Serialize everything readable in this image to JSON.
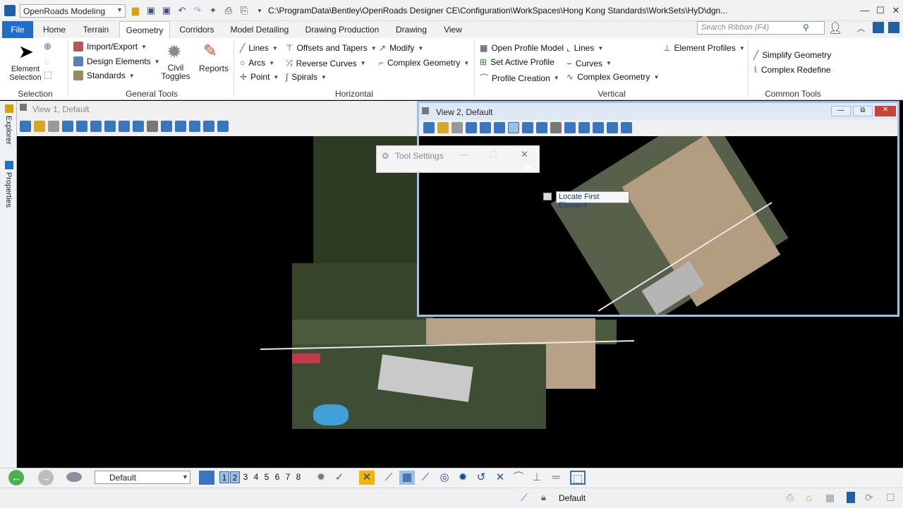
{
  "app": {
    "workspace": "OpenRoads Modeling",
    "path": "C:\\ProgramData\\Bentley\\OpenRoads Designer CE\\Configuration\\WorkSpaces\\Hong Kong Standards\\WorkSets\\HyD\\dgn..."
  },
  "tabs": [
    "File",
    "Home",
    "Terrain",
    "Geometry",
    "Corridors",
    "Model Detailing",
    "Drawing Production",
    "Drawing",
    "View"
  ],
  "search": {
    "placeholder": "Search Ribbon (F4)"
  },
  "ribbon": {
    "selection": {
      "label": "Selection",
      "element_selection": "Element Selection"
    },
    "general": {
      "label": "General Tools",
      "import_export": "Import/Export",
      "design_elements": "Design Elements",
      "standards": "Standards",
      "civil_toggles": "Civil Toggles",
      "reports": "Reports"
    },
    "horizontal": {
      "label": "Horizontal",
      "lines": "Lines",
      "arcs": "Arcs",
      "point": "Point",
      "offsets": "Offsets and Tapers",
      "reverse": "Reverse Curves",
      "spirals": "Spirals",
      "modify": "Modify",
      "complex": "Complex Geometry"
    },
    "vertical": {
      "label": "Vertical",
      "open_profile": "Open Profile Model",
      "set_active": "Set Active Profile",
      "profile_creation": "Profile Creation",
      "lines": "Lines",
      "curves": "Curves",
      "complex": "Complex Geometry",
      "element_profiles": "Element Profiles"
    },
    "common": {
      "label": "Common Tools",
      "simplify": "Simplify Geometry",
      "redefine": "Complex Redefine"
    }
  },
  "dock": {
    "explorer": "Explorer",
    "properties": "Properties"
  },
  "view1": {
    "title": "View 1, Default"
  },
  "view2": {
    "title": "View 2, Default"
  },
  "tool_settings": {
    "title": "Tool Settings"
  },
  "prompt": {
    "text": "Locate First Element"
  },
  "bottom": {
    "level": "Default",
    "views": [
      "1",
      "2",
      "3",
      "4",
      "5",
      "6",
      "7",
      "8"
    ]
  },
  "status": {
    "level": "Default"
  },
  "colors": {
    "accent": "#1f6fc9",
    "frame": "#9fc1e6"
  }
}
